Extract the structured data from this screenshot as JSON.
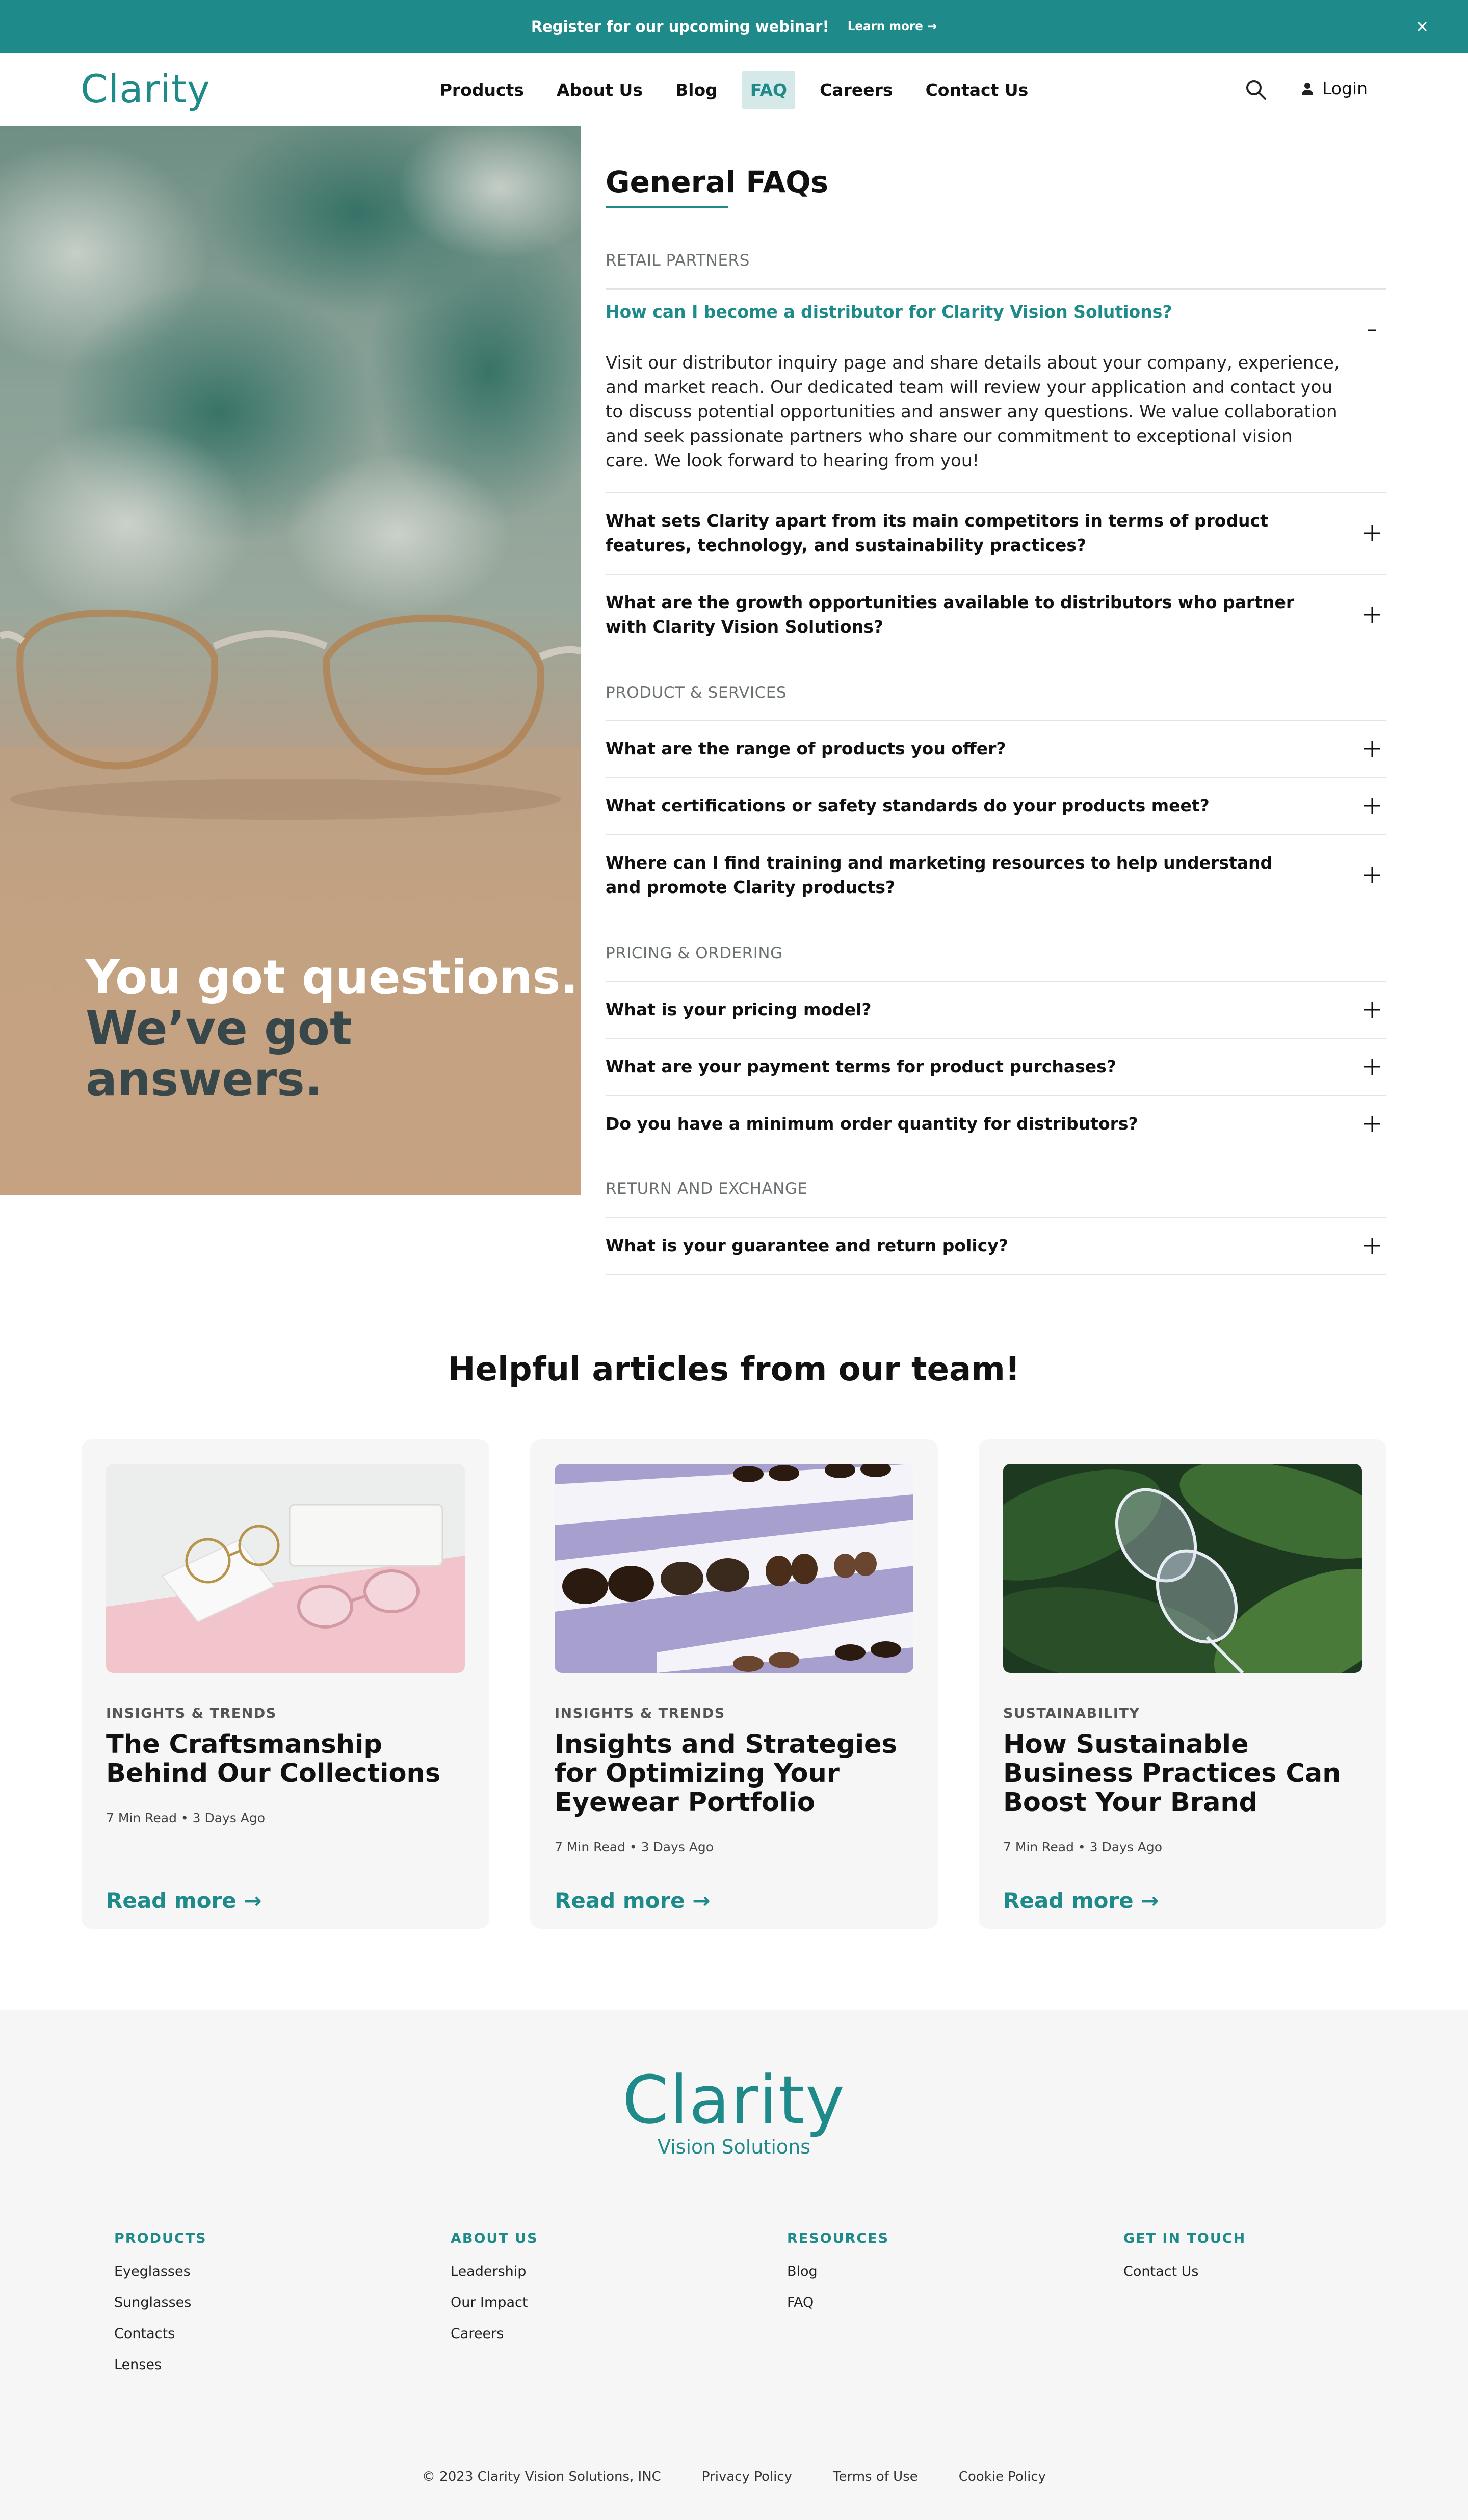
{
  "banner": {
    "text": "Register for our upcoming webinar!",
    "link": "Learn more →",
    "close_icon": "close-icon"
  },
  "header": {
    "logo": "Clarity",
    "nav": [
      "Products",
      "About Us",
      "Blog",
      "FAQ",
      "Careers",
      "Contact Us"
    ],
    "active_nav": "FAQ",
    "search_icon": "search-icon",
    "login": "Login",
    "login_icon": "user-icon"
  },
  "hero": {
    "line1": "You got questions.",
    "line2": "We’ve got answers."
  },
  "faq": {
    "title": "General FAQs",
    "categories": [
      {
        "label": "RETAIL PARTNERS",
        "items": [
          {
            "question": "How can I become a distributor for Clarity Vision Solutions?",
            "expanded": true,
            "answer": "Visit our distributor inquiry page and share details about your company, experience, and market reach. Our dedicated team will review your application and contact you to discuss potential opportunities and answer any questions. We value collaboration and seek passionate partners who share our commitment to exceptional vision care. We look forward to hearing from you!"
          },
          {
            "question": "What sets Clarity apart from its main competitors in terms of product features, technology, and sustainability practices?",
            "expanded": false
          },
          {
            "question": "What are the growth opportunities available to distributors who partner with Clarity Vision Solutions?",
            "expanded": false
          }
        ]
      },
      {
        "label": "PRODUCT & SERVICES",
        "items": [
          {
            "question": "What are the range of products you offer?",
            "expanded": false
          },
          {
            "question": "What certifications or safety standards do your products meet?",
            "expanded": false
          },
          {
            "question": "Where can I find training and marketing resources to help understand and promote Clarity products?",
            "expanded": false
          }
        ]
      },
      {
        "label": "PRICING & ORDERING",
        "items": [
          {
            "question": "What is your pricing model?",
            "expanded": false
          },
          {
            "question": "What are your payment terms for product purchases?",
            "expanded": false
          },
          {
            "question": "Do you have a minimum order quantity for distributors?",
            "expanded": false
          }
        ]
      },
      {
        "label": "RETURN AND EXCHANGE",
        "items": [
          {
            "question": "What is your guarantee and return policy?",
            "expanded": false
          }
        ]
      }
    ]
  },
  "articles": {
    "title": "Helpful articles from our team!",
    "cards": [
      {
        "tag": "INSIGHTS & TRENDS",
        "title": "The Craftsmanship Behind Our Collections",
        "meta": "7 Min Read • 3 Days Ago",
        "read_more": "Read more →"
      },
      {
        "tag": "INSIGHTS & TRENDS",
        "title": "Insights and Strategies for Optimizing Your Eyewear Portfolio",
        "meta": "7 Min Read • 3 Days Ago",
        "read_more": "Read more →"
      },
      {
        "tag": "SUSTAINABILITY",
        "title": "How Sustainable Business Practices Can Boost Your Brand",
        "meta": "7 Min Read • 3 Days Ago",
        "read_more": "Read more →"
      }
    ]
  },
  "footer": {
    "logo": "Clarity",
    "tagline": "Vision Solutions",
    "columns": [
      {
        "heading": "PRODUCTS",
        "links": [
          "Eyeglasses",
          "Sunglasses",
          "Contacts",
          "Lenses"
        ]
      },
      {
        "heading": "ABOUT US",
        "links": [
          "Leadership",
          "Our Impact",
          "Careers"
        ]
      },
      {
        "heading": "RESOURCES",
        "links": [
          "Blog",
          "FAQ"
        ]
      },
      {
        "heading": "GET IN TOUCH",
        "links": [
          "Contact Us"
        ]
      }
    ],
    "legal": [
      "© 2023 Clarity Vision Solutions, INC",
      "Privacy Policy",
      "Terms of Use",
      "Cookie Policy"
    ]
  },
  "colors": {
    "brand": "#1f8a8a",
    "active_nav_bg": "#d4e9e8",
    "card_bg": "#f6f6f6"
  }
}
